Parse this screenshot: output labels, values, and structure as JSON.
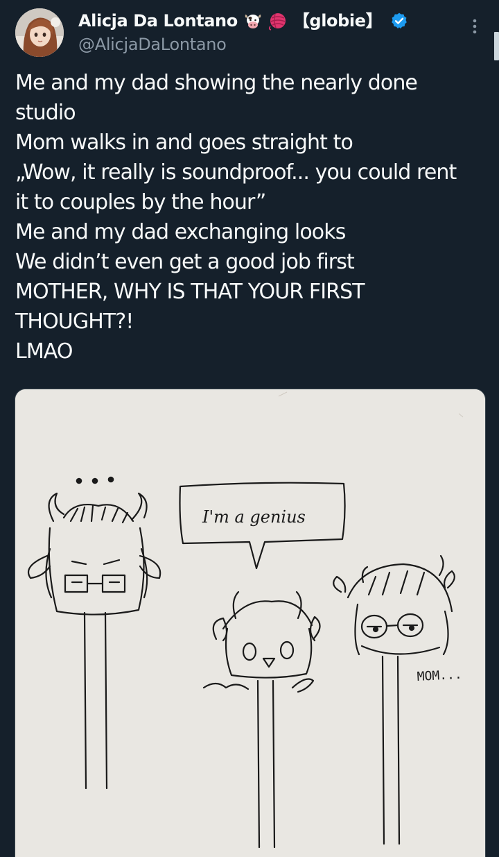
{
  "author": {
    "display_name": "Alicja Da Lontano",
    "name_suffix": "【globie】",
    "handle": "@AlicjaDaLontano",
    "verified": true,
    "emojis": [
      "cow-face-icon",
      "yarn-ball-icon"
    ],
    "verified_color": "#1d9bf0"
  },
  "tweet": {
    "lines": [
      "Me and my dad showing the nearly done",
      "studio",
      "Mom walks in and goes straight to",
      "„Wow, it really is soundproof... you could rent",
      "it to couples by the hour”",
      "Me and my dad exchanging looks",
      "We didn’t even get a good job first",
      "MOTHER, WHY IS THAT YOUR FIRST",
      "THOUGHT?!",
      "LMAO"
    ]
  },
  "media": {
    "speech_bubble_text": "I'm a genius",
    "dots_text": "•••",
    "mom_label": "MOM...",
    "paper_color": "#e9e7e2",
    "ink_color": "#1a1a1a"
  },
  "ui": {
    "more_icon": "more-vertical-icon",
    "background": "#15202b"
  }
}
